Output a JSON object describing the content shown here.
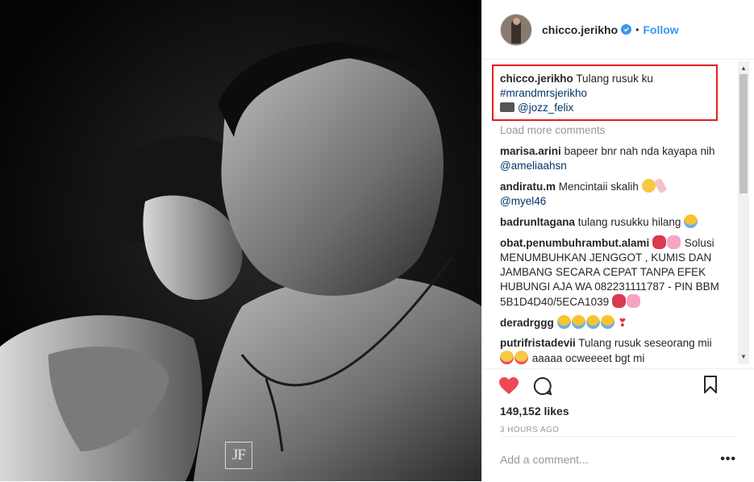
{
  "post": {
    "username": "chicco.jerikho",
    "separator": "•",
    "follow_label": "Follow",
    "watermark": "JF",
    "caption": {
      "user": "chicco.jerikho",
      "text": "Tulang rusuk ku",
      "hashtag": "#mrandmrsjerikho",
      "credit": "@jozz_felix"
    },
    "load_more": "Load more comments",
    "comments": [
      {
        "user": "marisa.arini",
        "text": "bapeer bnr nah nda kayapa nih",
        "mention": "@ameliaahsn"
      },
      {
        "user": "andiratu.m",
        "text": "Mencintaii skalih",
        "mention": "@myel46"
      },
      {
        "user": "badrunltagana",
        "text": "tulang rusukku hilang"
      },
      {
        "user": "obat.penumbuhrambut.alami",
        "text": "Solusi MENUMBUHKAN JENGGOT , KUMIS DAN JAMBANG SECARA CEPAT TANPA EFEK HUBUNGI AJA WA 082231111787 - PIN BBM 5B1D4D40/5ECA1039"
      },
      {
        "user": "deradrggg",
        "text": ""
      },
      {
        "user": "putrifristadevii",
        "text": "Tulang rusuk seseorang mii",
        "text2": "aaaaa ocweeeet bgt mi"
      }
    ],
    "likes": "149,152 likes",
    "time": "3 HOURS AGO",
    "add_comment_placeholder": "Add a comment...",
    "more_label": "•••",
    "colors": {
      "accent": "#3897f0",
      "highlight_box": "#e31e1e",
      "like_heart": "#ed4956"
    },
    "icons": [
      "verified-badge-icon",
      "camera-icon",
      "heart-icon",
      "comment-icon",
      "bookmark-icon",
      "more-options-icon"
    ]
  }
}
